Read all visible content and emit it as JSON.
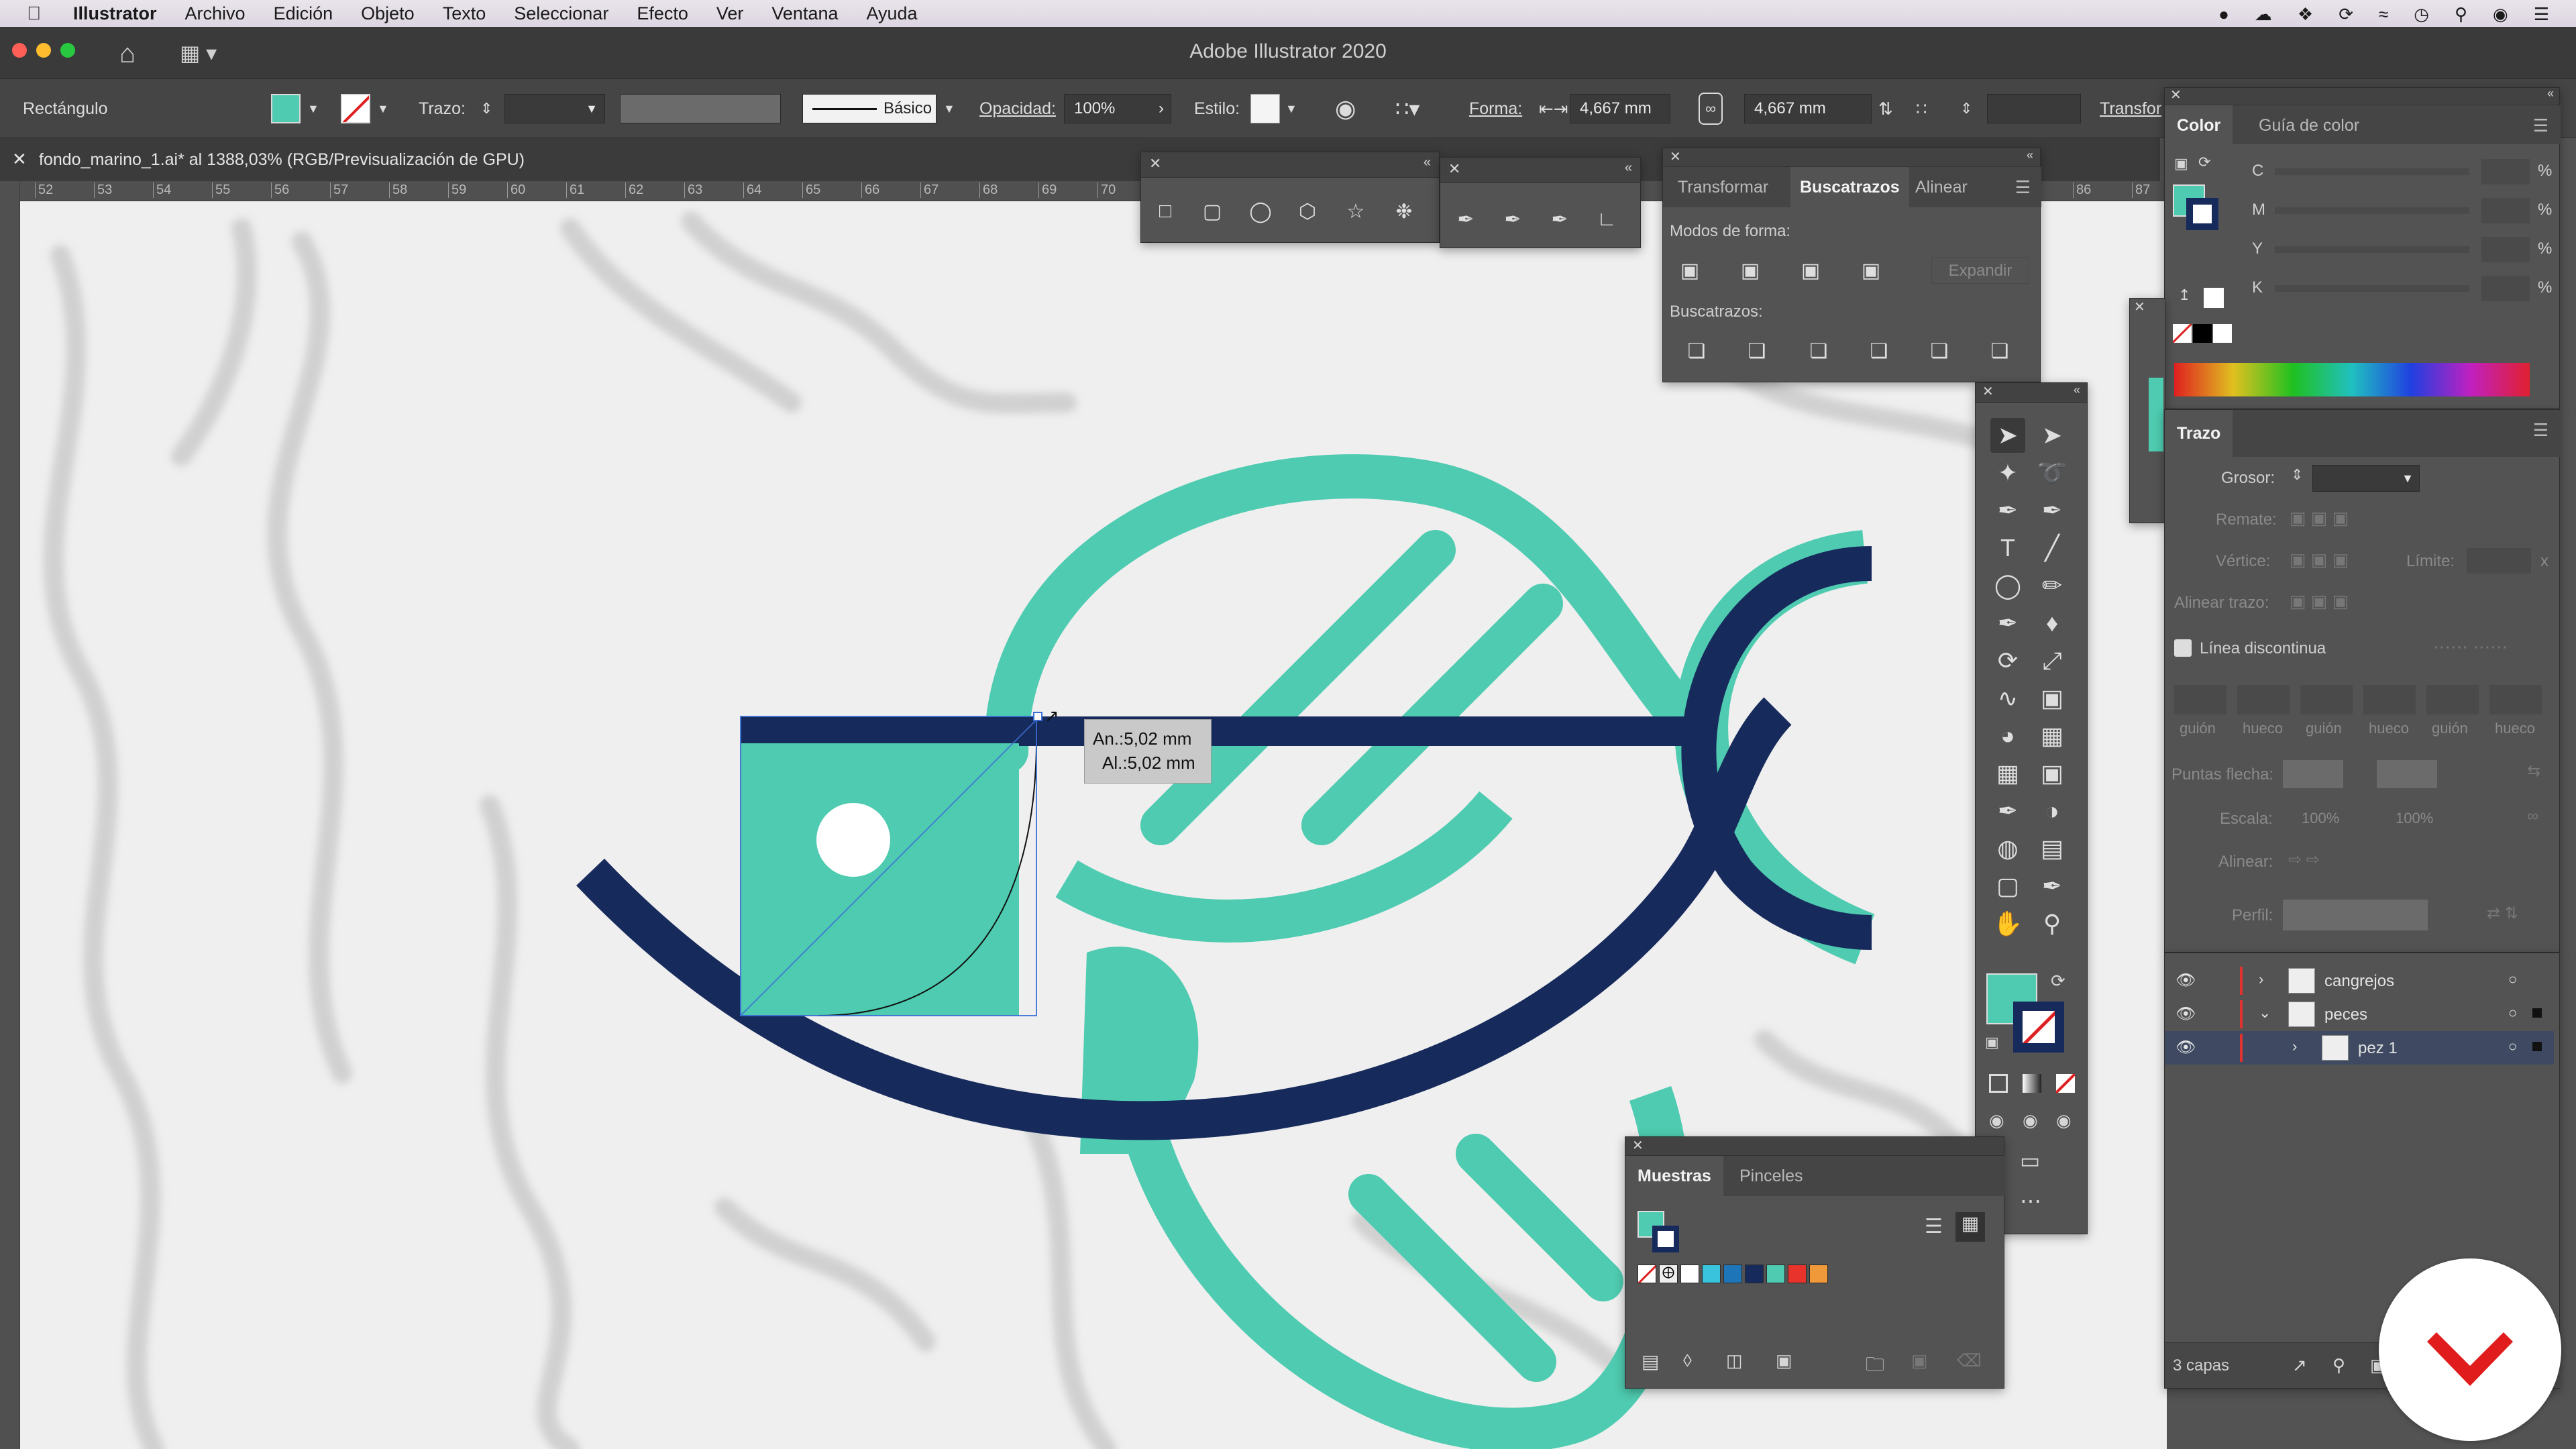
{
  "menubar": {
    "app": "Illustrator",
    "items": [
      "Archivo",
      "Edición",
      "Objeto",
      "Texto",
      "Seleccionar",
      "Efecto",
      "Ver",
      "Ventana",
      "Ayuda"
    ]
  },
  "window": {
    "title": "Adobe Illustrator 2020"
  },
  "controlbar": {
    "selection_type": "Rectángulo",
    "fill_color": "#4ecbb0",
    "stroke_label": "Trazo:",
    "brush_label": "Básico",
    "opacity_label": "Opacidad:",
    "opacity_value": "100%",
    "style_label": "Estilo:",
    "shape_label": "Forma:",
    "width_value": "4,667 mm",
    "height_value": "4,667 mm",
    "transform_label": "Transfor"
  },
  "document": {
    "tab_title": "fondo_marino_1.ai* al 1388,03% (RGB/Previsualización de GPU)"
  },
  "ruler": {
    "ticks": [
      "52",
      "53",
      "54",
      "55",
      "56",
      "57",
      "58",
      "59",
      "60",
      "61",
      "62",
      "63",
      "64",
      "65",
      "66",
      "67",
      "68",
      "69",
      "70"
    ],
    "right_ticks": [
      "86",
      "87"
    ]
  },
  "canvas": {
    "tooltip_width": "An.:5,02 mm",
    "tooltip_height": "Al.:5,02 mm",
    "colors": {
      "teal": "#4ecbb0",
      "navy": "#172a5c",
      "background": "#efefef"
    }
  },
  "pathfinder": {
    "tabs": [
      "Transformar",
      "Buscatrazos",
      "Alinear"
    ],
    "active_tab": "Buscatrazos",
    "shape_modes_label": "Modos de forma:",
    "expand_label": "Expandir",
    "pathfinders_label": "Buscatrazos:"
  },
  "color_panel": {
    "tabs": [
      "Color",
      "Guía de color"
    ],
    "channels": [
      {
        "name": "C",
        "unit": "%"
      },
      {
        "name": "M",
        "unit": "%"
      },
      {
        "name": "Y",
        "unit": "%"
      },
      {
        "name": "K",
        "unit": "%"
      }
    ]
  },
  "stroke_panel": {
    "title": "Trazo",
    "weight_label": "Grosor:",
    "cap_label": "Remate:",
    "corner_label": "Vértice:",
    "limit_label": "Límite:",
    "limit_unit": "x",
    "align_label": "Alinear trazo:",
    "dashed_label": "Línea discontinua",
    "dash_labels": [
      "guión",
      "hueco",
      "guión",
      "hueco",
      "guión",
      "hueco"
    ],
    "arrowheads_label": "Puntas flecha:",
    "scale_label": "Escala:",
    "scale_values": [
      "100%",
      "100%"
    ],
    "align_arrows_label": "Alinear:",
    "profile_label": "Perfil:"
  },
  "layers": {
    "items": [
      {
        "name": "cangrejos",
        "color": "#e0322f",
        "indent": 0,
        "expanded": false
      },
      {
        "name": "peces",
        "color": "#e0322f",
        "indent": 0,
        "expanded": true
      },
      {
        "name": "pez 1",
        "color": "#e0322f",
        "indent": 1,
        "expanded": false,
        "selected": true
      }
    ],
    "count_label": "3 capas"
  },
  "swatches_panel": {
    "tabs": [
      "Muestras",
      "Pinceles"
    ],
    "active_tab": "Muestras",
    "swatches": [
      "#ffffff",
      "#39c3dc",
      "#1e75b8",
      "#172a5c",
      "#4ecbb0",
      "#e8322c",
      "#f0993b"
    ]
  },
  "toolbar": {
    "fill_color": "#4ecbb0",
    "stroke_color": "#172a5c"
  },
  "logo": {
    "color": "#e11c1c"
  }
}
